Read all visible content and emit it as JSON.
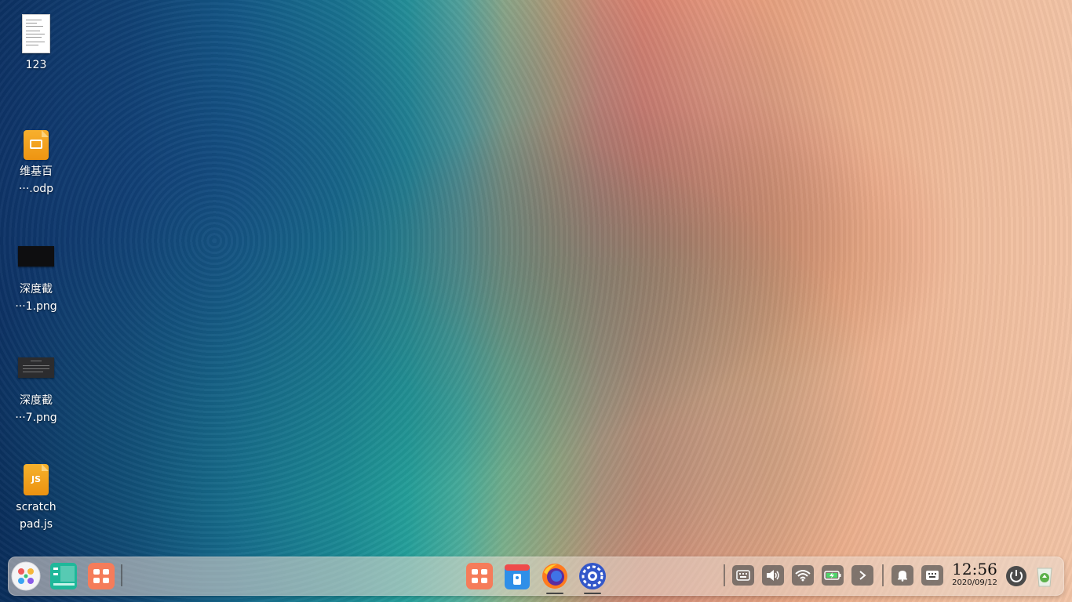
{
  "desktop": {
    "icons": [
      {
        "label": "123",
        "type": "text-document"
      },
      {
        "label_lines": [
          "维基百",
          "···.odp"
        ],
        "type": "odp-presentation"
      },
      {
        "label_lines": [
          "深度截",
          "···1.png"
        ],
        "type": "png-image"
      },
      {
        "label_lines": [
          "深度截",
          "···7.png"
        ],
        "type": "png-image"
      },
      {
        "label_lines": [
          "scratch",
          "pad.js"
        ],
        "type": "javascript-file",
        "badge": "JS"
      }
    ]
  },
  "dock": {
    "left_apps": [
      {
        "name": "launcher",
        "icon": "launcher-icon"
      },
      {
        "name": "multitasking-view",
        "icon": "multitasking-icon"
      },
      {
        "name": "app-store",
        "icon": "app-store-icon"
      }
    ],
    "center_apps": [
      {
        "name": "app-store",
        "icon": "app-store-icon",
        "running": false
      },
      {
        "name": "calendar",
        "icon": "calendar-icon",
        "running": false
      },
      {
        "name": "firefox",
        "icon": "firefox-icon",
        "running": true
      },
      {
        "name": "control-center",
        "icon": "control-center-icon",
        "running": true
      }
    ],
    "tray": [
      {
        "name": "onscreen-keyboard",
        "icon": "keyboard-icon"
      },
      {
        "name": "volume",
        "icon": "volume-icon"
      },
      {
        "name": "network",
        "icon": "wifi-icon"
      },
      {
        "name": "battery",
        "icon": "battery-charging-icon"
      },
      {
        "name": "expand-tray",
        "icon": "chevron-right-icon"
      },
      {
        "name": "notifications",
        "icon": "bell-icon"
      },
      {
        "name": "input-method",
        "icon": "keyboard-layout-icon"
      }
    ],
    "clock": {
      "time": "12:56",
      "date": "2020/09/12"
    },
    "power": {
      "icon": "power-icon"
    },
    "trash": {
      "icon": "trash-icon"
    }
  },
  "colors": {
    "dock_bg": "#ebdcd2",
    "tray_btn": "#464646",
    "accent_orange": "#f2a027"
  }
}
